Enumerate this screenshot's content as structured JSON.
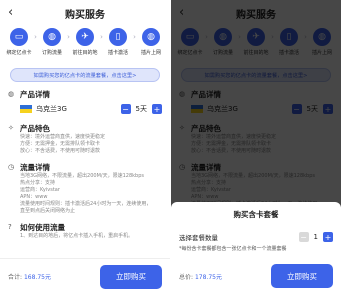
{
  "colors": {
    "accent": "#3d63e8",
    "banner_bg": "#dfe5fb",
    "overlay": "rgba(0,0,0,0.72)"
  },
  "header": {
    "back_icon": "chevron-left-icon",
    "title": "购买服务"
  },
  "steps": [
    {
      "icon": "sim-card-icon",
      "label": "绑定亿点卡"
    },
    {
      "icon": "globe-icon",
      "label": "订购流量"
    },
    {
      "icon": "plane-icon",
      "label": "前往目的地"
    },
    {
      "icon": "phone-icon",
      "label": "插卡激活"
    },
    {
      "icon": "globe-icon",
      "label": "插片上网"
    }
  ],
  "banner": "如需购买您的亿点卡的流量套餐，点击这里>",
  "product_detail": {
    "title": "产品详情",
    "name": "乌克兰3G",
    "quantity": "5天"
  },
  "features": {
    "title": "产品特色",
    "lines": [
      "快速：境外运营商直供，速度快更稳定",
      "方便：无需押金，无需排队领卡取卡",
      "放心：不含话费，不使用可随时退款"
    ]
  },
  "flow_detail": {
    "title": "流量详情",
    "lines": [
      "当地3G网络，不限流量，超出200M/天，限速128kbps",
      "热点分享：支持",
      "运营商：Kyivstar",
      "APN：www",
      "流量使用时间规则：插卡激活后24小时为一天，连续使用，",
      "直至到点后关闭网络为止"
    ]
  },
  "how_to": {
    "title": "如何使用流量",
    "lines": [
      "1、到达目的地后，将亿点卡插入手机，重启手机。"
    ]
  },
  "footer": {
    "total_label": "合计:",
    "total_amount": "168.75元",
    "buy_label": "立即购买"
  },
  "sheet": {
    "title": "购买含卡套餐",
    "qty_label": "选择套餐数量",
    "qty_value": "1",
    "note": "*每份含卡套餐都包含一张亿点卡和一个流量套餐",
    "total_label": "总价:",
    "total_amount": "178.75元",
    "buy_label": "立即购买"
  }
}
